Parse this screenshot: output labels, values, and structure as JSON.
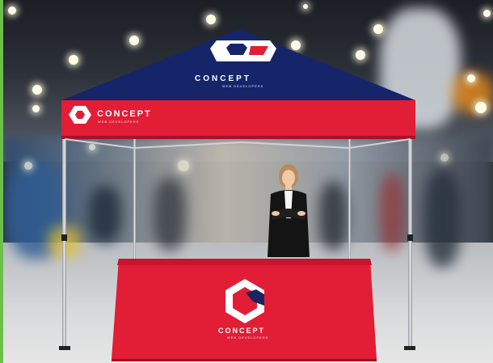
{
  "scene": {
    "description_tag": "trade-show-canopy-tent",
    "colors": {
      "canopy_top": "#16256a",
      "canopy_valance": "#e21d36",
      "table_cloth": "#e21d36",
      "accent_green": "#6cc04a",
      "logo_red": "#e21d36",
      "logo_navy": "#1a2560"
    }
  },
  "canopy": {
    "top_brand": "CONCEPT",
    "top_brand_sub": "WEB DEVELOPERS",
    "valance_brand": "CONCEPT",
    "valance_brand_sub": "WEB DEVELOPERS"
  },
  "table": {
    "brand": "CONCEPT",
    "brand_sub": "WEB DEVELOPERS"
  },
  "icons": {
    "logo": "hexagon-logo-icon"
  }
}
